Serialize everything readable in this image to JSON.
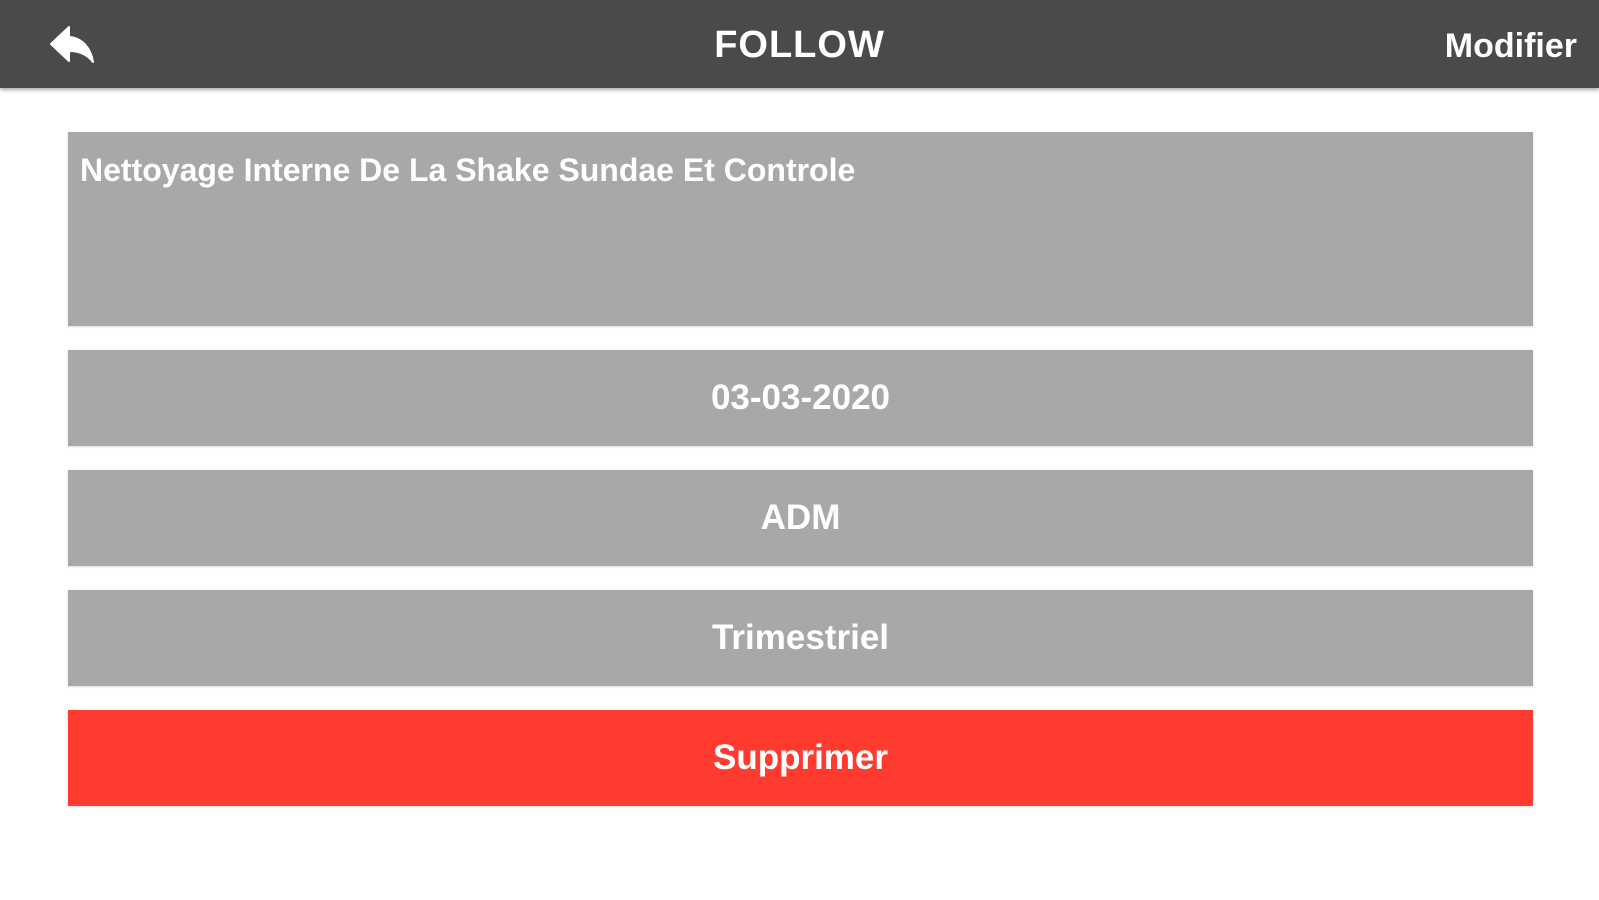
{
  "header": {
    "back_icon": "back-arrow-icon",
    "title": "FOLLOW",
    "edit_label": "Modifier",
    "background_color": "#4a4a4a"
  },
  "form": {
    "description": "Nettoyage Interne De La Shake Sundae Et Controle",
    "date": "03-03-2020",
    "assignee": "ADM",
    "frequency": "Trimestriel",
    "field_color": "#a8a8a8"
  },
  "actions": {
    "delete_label": "Supprimer",
    "delete_color": "#ff3b30"
  }
}
